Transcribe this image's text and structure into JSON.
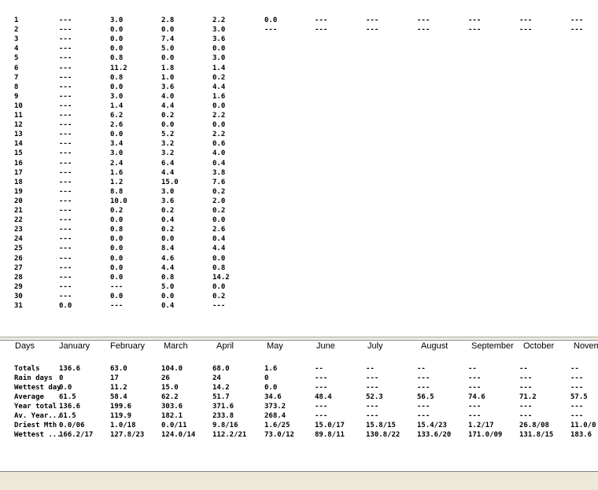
{
  "daily_table": {
    "rows": [
      [
        "1",
        "---",
        "3.0",
        "2.8",
        "2.2",
        "0.0",
        "---",
        "---",
        "---",
        "---",
        "---",
        "---"
      ],
      [
        "2",
        "---",
        "0.0",
        "0.0",
        "3.0",
        "---",
        "---",
        "---",
        "---",
        "---",
        "---",
        "---"
      ],
      [
        "3",
        "---",
        "0.0",
        "7.4",
        "3.6"
      ],
      [
        "4",
        "---",
        "0.0",
        "5.0",
        "0.0"
      ],
      [
        "5",
        "---",
        "0.8",
        "0.0",
        "3.0"
      ],
      [
        "6",
        "---",
        "11.2",
        "1.8",
        "1.4"
      ],
      [
        "7",
        "---",
        "0.8",
        "1.0",
        "0.2"
      ],
      [
        "8",
        "---",
        "0.0",
        "3.6",
        "4.4"
      ],
      [
        "9",
        "---",
        "3.0",
        "4.0",
        "1.6"
      ],
      [
        "10",
        "---",
        "1.4",
        "4.4",
        "0.0"
      ],
      [
        "11",
        "---",
        "6.2",
        "0.2",
        "2.2"
      ],
      [
        "12",
        "---",
        "2.6",
        "0.0",
        "0.0"
      ],
      [
        "13",
        "---",
        "0.0",
        "5.2",
        "2.2"
      ],
      [
        "14",
        "---",
        "3.4",
        "3.2",
        "0.6"
      ],
      [
        "15",
        "---",
        "3.0",
        "3.2",
        "4.0"
      ],
      [
        "16",
        "---",
        "2.4",
        "6.4",
        "0.4"
      ],
      [
        "17",
        "---",
        "1.6",
        "4.4",
        "3.8"
      ],
      [
        "18",
        "---",
        "1.2",
        "15.0",
        "7.6"
      ],
      [
        "19",
        "---",
        "8.8",
        "3.0",
        "0.2"
      ],
      [
        "20",
        "---",
        "10.0",
        "3.6",
        "2.0"
      ],
      [
        "21",
        "---",
        "0.2",
        "0.2",
        "0.2"
      ],
      [
        "22",
        "---",
        "0.0",
        "0.4",
        "0.0"
      ],
      [
        "23",
        "---",
        "0.8",
        "0.2",
        "2.6"
      ],
      [
        "24",
        "---",
        "0.0",
        "0.0",
        "0.4"
      ],
      [
        "25",
        "---",
        "0.0",
        "8.4",
        "4.4"
      ],
      [
        "26",
        "---",
        "0.0",
        "4.6",
        "0.0"
      ],
      [
        "27",
        "---",
        "0.0",
        "4.4",
        "0.8"
      ],
      [
        "28",
        "---",
        "0.0",
        "0.8",
        "14.2"
      ],
      [
        "29",
        "---",
        "---",
        "5.0",
        "0.0"
      ],
      [
        "30",
        "---",
        "0.0",
        "0.0",
        "0.2"
      ],
      [
        "31",
        "0.0",
        "---",
        "0.4",
        "---"
      ]
    ]
  },
  "summary_table": {
    "columns": [
      "Days",
      "January",
      "February",
      "March",
      "April",
      "May",
      "June",
      "July",
      "August",
      "September",
      "October",
      "Novem"
    ],
    "rows": [
      [
        "Totals",
        "136.6",
        "63.0",
        "104.0",
        "68.0",
        "1.6",
        "--",
        "--",
        "--",
        "--",
        "--",
        "--"
      ],
      [
        "Rain days",
        "0",
        "17",
        "26",
        "24",
        "0",
        "---",
        "---",
        "---",
        "---",
        "---",
        "---"
      ],
      [
        "Wettest day",
        "0.0",
        "11.2",
        "15.0",
        "14.2",
        "0.0",
        "---",
        "---",
        "---",
        "---",
        "---",
        "---"
      ],
      [
        "Average",
        "61.5",
        "58.4",
        "62.2",
        "51.7",
        "34.6",
        "48.4",
        "52.3",
        "56.5",
        "74.6",
        "71.2",
        "57.5"
      ],
      [
        "Year total",
        "136.6",
        "199.6",
        "303.6",
        "371.6",
        "373.2",
        "---",
        "---",
        "---",
        "---",
        "---",
        "---"
      ],
      [
        "Av. Year...",
        "61.5",
        "119.9",
        "182.1",
        "233.8",
        "268.4",
        "---",
        "---",
        "---",
        "---",
        "---",
        "---"
      ],
      [
        "Driest Mth",
        "0.0/06",
        "1.0/18",
        "0.0/11",
        "9.8/16",
        "1.6/25",
        "15.0/17",
        "15.8/15",
        "15.4/23",
        "1.2/17",
        "26.8/08",
        "11.0/0"
      ],
      [
        "Wettest ...",
        "166.2/17",
        "127.8/23",
        "124.0/14",
        "112.2/21",
        "73.0/12",
        "89.8/11",
        "130.8/22",
        "133.6/20",
        "171.0/09",
        "131.8/15",
        "183.6"
      ]
    ]
  }
}
